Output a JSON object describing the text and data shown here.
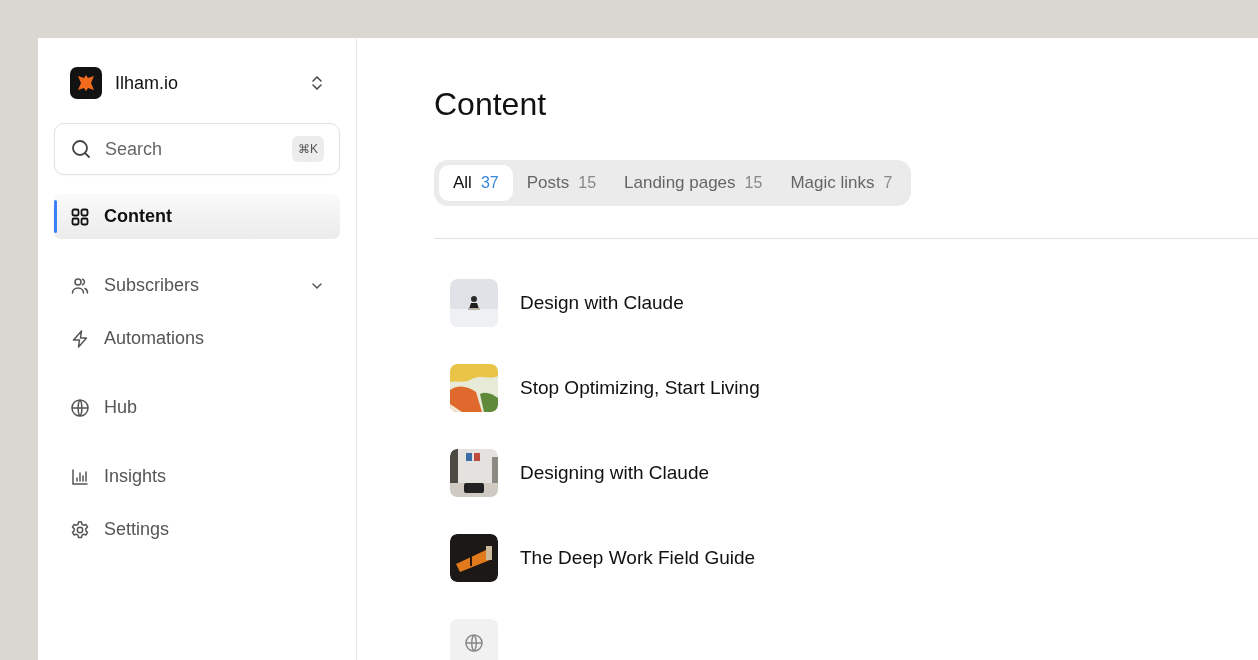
{
  "workspace": {
    "name": "Ilham.io"
  },
  "search": {
    "placeholder": "Search",
    "shortcut": "⌘K"
  },
  "nav_groups": [
    [
      {
        "label": "Content",
        "selected": true
      }
    ],
    [
      {
        "label": "Subscribers",
        "selected": false,
        "expandable": true
      },
      {
        "label": "Automations",
        "selected": false
      }
    ],
    [
      {
        "label": "Hub",
        "selected": false
      }
    ],
    [
      {
        "label": "Insights",
        "selected": false
      },
      {
        "label": "Settings",
        "selected": false
      }
    ]
  ],
  "page": {
    "title": "Content"
  },
  "tabs": [
    {
      "label": "All",
      "count": "37",
      "selected": true
    },
    {
      "label": "Posts",
      "count": "15",
      "selected": false
    },
    {
      "label": "Landing pages",
      "count": "15",
      "selected": false
    },
    {
      "label": "Magic links",
      "count": "7",
      "selected": false
    }
  ],
  "items": [
    {
      "title": "Design with Claude",
      "kind": "picture"
    },
    {
      "title": "Stop Optimizing, Start Living",
      "kind": "picture"
    },
    {
      "title": "Designing with Claude",
      "kind": "picture"
    },
    {
      "title": "The Deep Work Field Guide",
      "kind": "picture"
    },
    {
      "kind": "icon"
    }
  ]
}
